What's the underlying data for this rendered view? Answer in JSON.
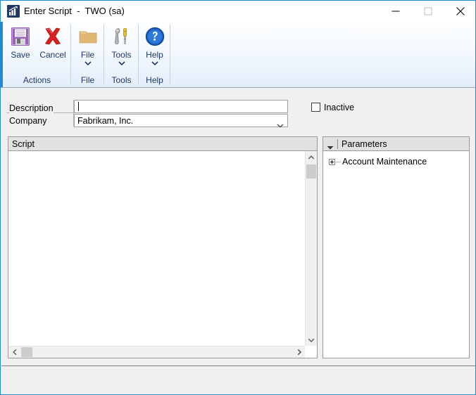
{
  "window": {
    "title": "Enter Script  -  TWO (sa)",
    "icon": "chart-app-icon",
    "accent_color": "#1f8ad2",
    "controls": {
      "minimize": "minimize-icon",
      "maximize": "maximize-icon",
      "close": "close-icon"
    }
  },
  "ribbon": {
    "groups": [
      {
        "label": "Actions",
        "buttons": [
          {
            "label": "Save",
            "icon": "floppy-disk-icon",
            "has_dropdown": false
          },
          {
            "label": "Cancel",
            "icon": "red-x-icon",
            "has_dropdown": false
          }
        ]
      },
      {
        "label": "File",
        "buttons": [
          {
            "label": "File",
            "icon": "folder-icon",
            "has_dropdown": true
          }
        ]
      },
      {
        "label": "Tools",
        "buttons": [
          {
            "label": "Tools",
            "icon": "wrench-screwdriver-icon",
            "has_dropdown": true
          }
        ]
      },
      {
        "label": "Help",
        "buttons": [
          {
            "label": "Help",
            "icon": "blue-question-icon",
            "has_dropdown": true
          }
        ]
      }
    ]
  },
  "form": {
    "description": {
      "label": "Description",
      "value": "",
      "placeholder": ""
    },
    "company": {
      "label": "Company",
      "value": "Fabrikam, Inc.",
      "arrow_icon": "chevron-down-icon"
    },
    "inactive": {
      "label": "Inactive",
      "checked": false
    }
  },
  "script_panel": {
    "header": "Script",
    "value": "",
    "scrollbars": {
      "vertical": {
        "up_icon": "scroll-up-arrow-icon",
        "down_icon": "scroll-down-arrow-icon"
      },
      "horizontal": {
        "left_icon": "scroll-left-arrow-icon",
        "right_icon": "scroll-right-arrow-icon"
      }
    }
  },
  "parameters_panel": {
    "header": "Parameters",
    "collapse_icon": "chevron-down-icon",
    "tree": [
      {
        "label": "Account Maintenance",
        "expander": "plus-box-icon",
        "expanded": false
      }
    ]
  }
}
